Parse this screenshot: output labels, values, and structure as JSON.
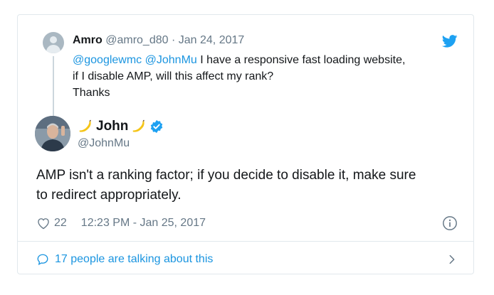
{
  "reply_to": {
    "name": "Amro",
    "handle": "@amro_d80",
    "separator": "·",
    "date": "Jan 24, 2017",
    "mention1": "@googlewmc",
    "mention2": "@JohnMu",
    "line1_rest": "I have a responsive fast loading website,",
    "line2": "if I disable AMP, will this affect my rank?",
    "line3": "Thanks"
  },
  "tweet": {
    "author_name": "John",
    "author_handle": "@JohnMu",
    "verified": true,
    "text_line1": "AMP isn't a ranking factor; if you decide to disable it, make sure",
    "text_line2": "to redirect appropriately.",
    "likes": "22",
    "timestamp": "12:23 PM - Jan 25, 2017"
  },
  "footer": {
    "talking_label": "17 people are talking about this"
  },
  "colors": {
    "brand_blue": "#1da1f2",
    "link_blue": "#1b95e0",
    "muted": "#657786",
    "banana_yellow": "#f5c518"
  },
  "icons": [
    "twitter-bird-icon",
    "banana-icon",
    "verified-badge-icon",
    "heart-icon",
    "info-icon",
    "speech-bubble-icon",
    "chevron-right-icon"
  ]
}
